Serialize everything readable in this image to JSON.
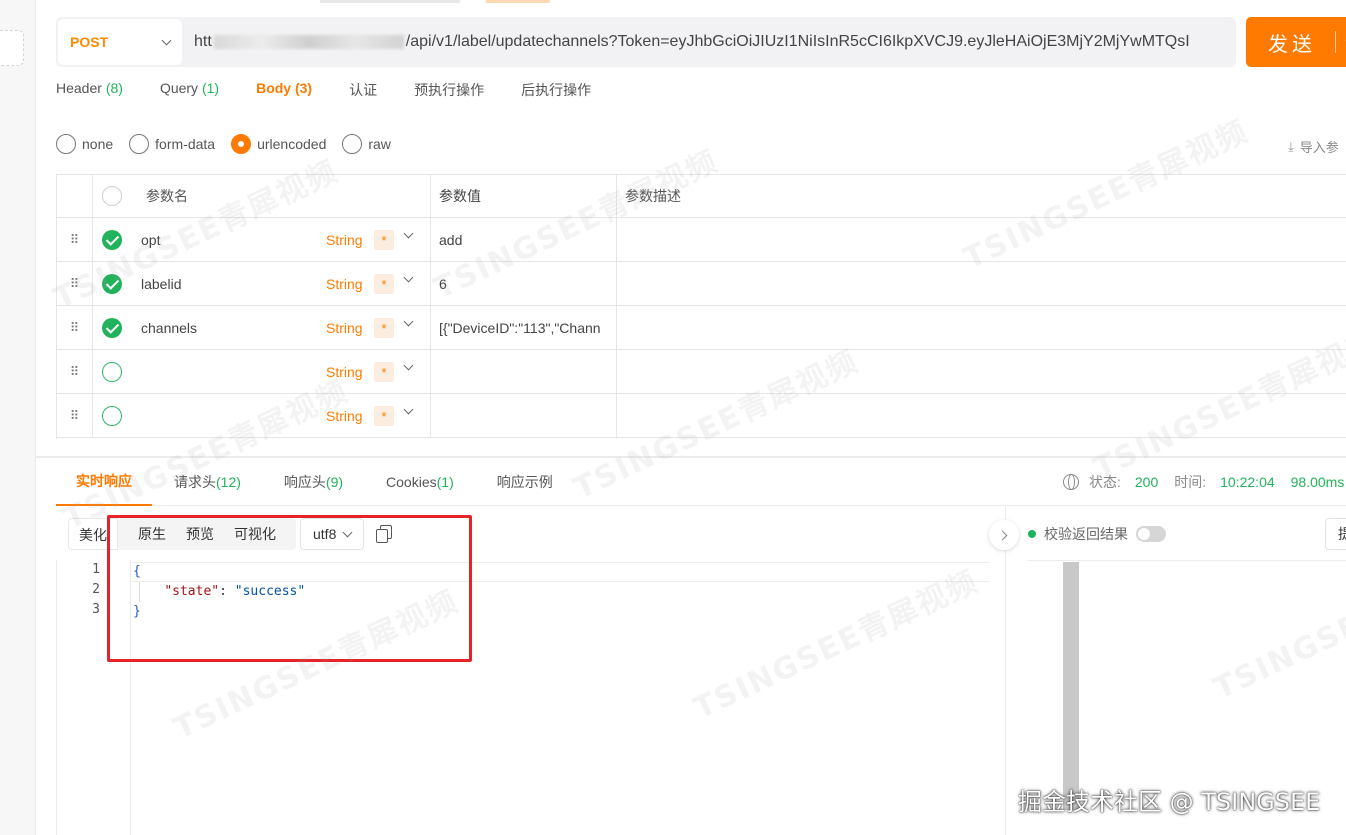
{
  "request": {
    "method": "POST",
    "url_prefix": "htt",
    "url_path": "/api/v1/label/updatechannels?Token=eyJhbGciOiJIUzI1NiIsInR5cCI6IkpXVCJ9.eyJleHAiOjE3MjY2MjYwMTQsI",
    "send_label": "发送"
  },
  "request_tabs": [
    {
      "label": "Header",
      "count": "(8)"
    },
    {
      "label": "Query",
      "count": "(1)"
    },
    {
      "label": "Body",
      "count": "(3)"
    },
    {
      "label": "认证",
      "count": ""
    },
    {
      "label": "预执行操作",
      "count": ""
    },
    {
      "label": "后执行操作",
      "count": ""
    }
  ],
  "body_types": [
    "none",
    "form-data",
    "urlencoded",
    "raw"
  ],
  "selected_body_type": "urlencoded",
  "import_label": "导入参",
  "params_table": {
    "headers": {
      "name": "参数名",
      "value": "参数值",
      "desc": "参数描述"
    },
    "rows": [
      {
        "enabled": true,
        "name": "opt",
        "type": "String",
        "required": "*",
        "value": "add",
        "desc": ""
      },
      {
        "enabled": true,
        "name": "labelid",
        "type": "String",
        "required": "*",
        "value": "6",
        "desc": ""
      },
      {
        "enabled": true,
        "name": "channels",
        "type": "String",
        "required": "*",
        "value": "[{\"DeviceID\":\"113\",\"Chann",
        "desc": ""
      },
      {
        "enabled": false,
        "name": "",
        "type": "String",
        "required": "*",
        "value": "",
        "desc": ""
      },
      {
        "enabled": false,
        "name": "",
        "type": "String",
        "required": "*",
        "value": "",
        "desc": ""
      }
    ]
  },
  "response_tabs": [
    {
      "label": "实时响应",
      "count": ""
    },
    {
      "label": "请求头",
      "count": "(12)"
    },
    {
      "label": "响应头",
      "count": "(9)"
    },
    {
      "label": "Cookies",
      "count": "(1)"
    },
    {
      "label": "响应示例",
      "count": ""
    }
  ],
  "response_status": {
    "status_label": "状态:",
    "status_value": "200",
    "time_label": "时间:",
    "time_value": "10:22:04",
    "duration": "98.00ms"
  },
  "view_modes": {
    "pretty": "美化",
    "raw": "原生",
    "preview": "预览",
    "visualize": "可视化",
    "encoding": "utf8"
  },
  "response_body": {
    "line_numbers": [
      "1",
      "2",
      "3"
    ],
    "open_brace": "{",
    "key": "\"state\"",
    "colon": ": ",
    "value": "\"success\"",
    "close_brace": "}"
  },
  "validate_label": "校验返回结果",
  "side_button_label": "提",
  "watermark_text": "TSINGSEE青犀视频",
  "credit": "掘金技术社区 @ TSINGSEE",
  "colors": {
    "accent": "#ff7a00",
    "success": "#21b35b",
    "annotation_box": "#e5232a"
  }
}
